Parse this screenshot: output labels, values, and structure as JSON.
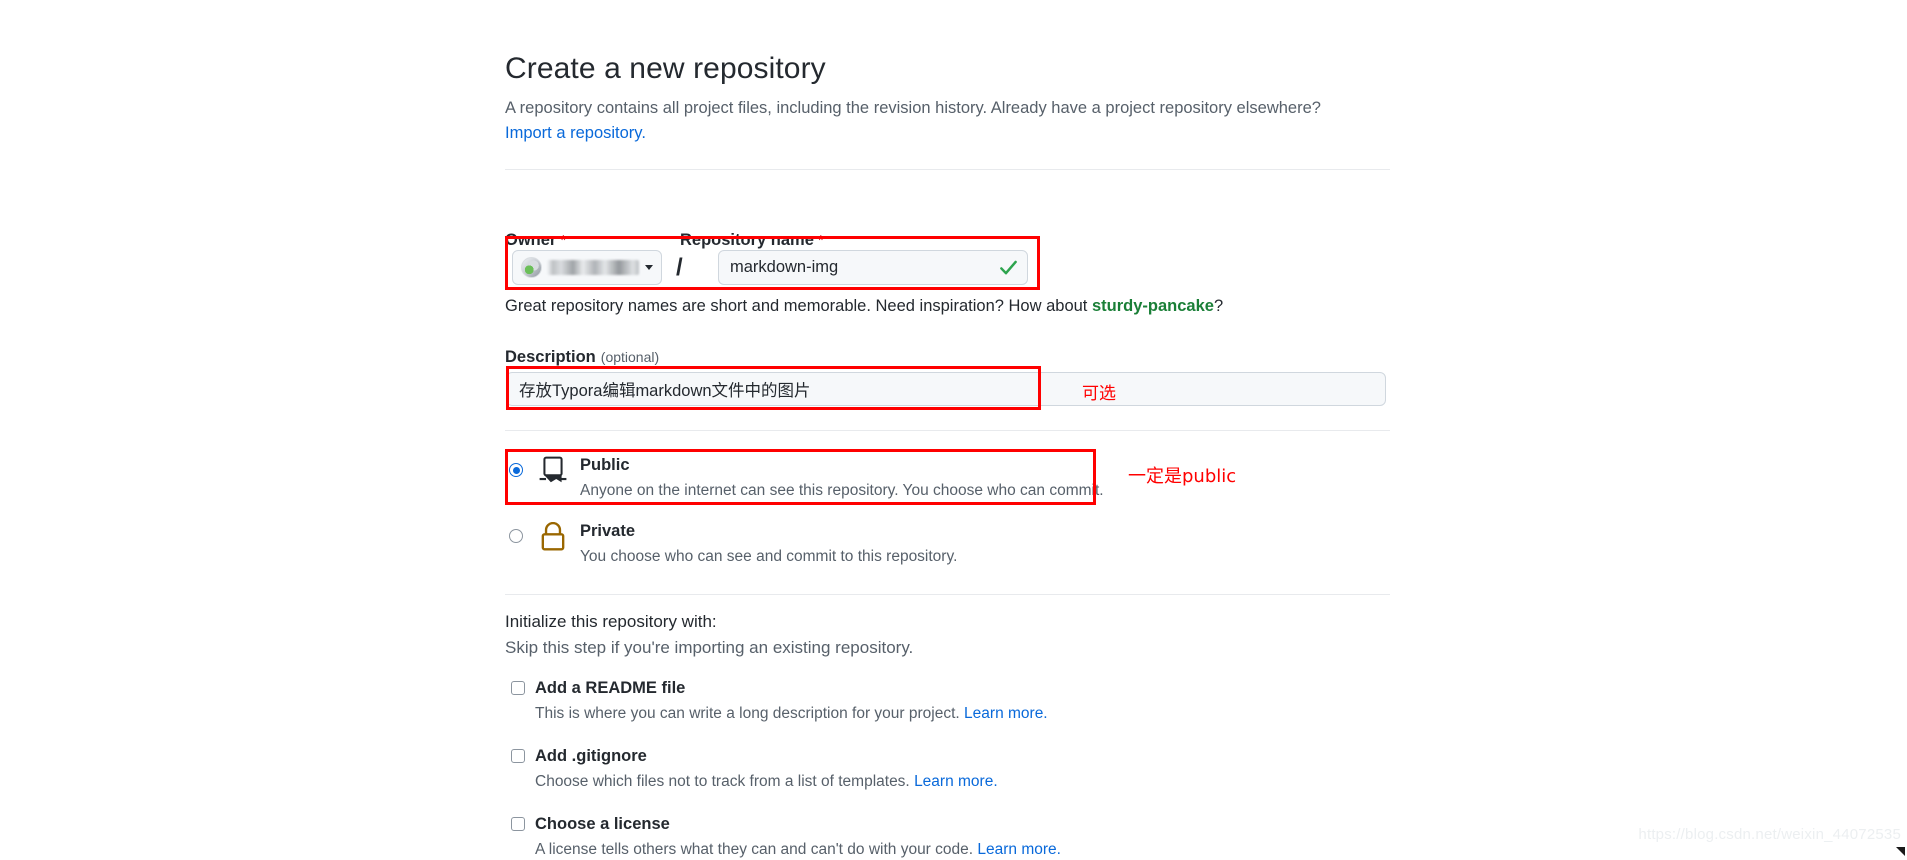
{
  "header": {
    "title": "Create a new repository",
    "subtitle": "A repository contains all project files, including the revision history. Already have a project repository elsewhere?",
    "import_link": "Import a repository."
  },
  "owner_field": {
    "label": "Owner",
    "required_mark": "*",
    "selected_value": "",
    "avatar_icon": "user-avatar-icon",
    "caret_icon": "chevron-down-icon"
  },
  "separator": "/",
  "repo_name_field": {
    "label": "Repository name",
    "required_mark": "*",
    "value": "markdown-img",
    "placeholder": "",
    "valid_icon": "check-icon"
  },
  "hint": {
    "prefix": "Great repository names are short and memorable. Need inspiration? How about ",
    "suggestion": "sturdy-pancake",
    "suffix": "?"
  },
  "description_field": {
    "label": "Description",
    "optional_note": "(optional)",
    "value": "存放Typora编辑markdown文件中的图片",
    "placeholder": ""
  },
  "visibility": {
    "public": {
      "title": "Public",
      "description": "Anyone on the internet can see this repository. You choose who can commit.",
      "selected": true,
      "icon": "open-book-icon"
    },
    "private": {
      "title": "Private",
      "description": "You choose who can see and commit to this repository.",
      "selected": false,
      "icon": "lock-icon"
    }
  },
  "initialize": {
    "title": "Initialize this repository with:",
    "subtitle": "Skip this step if you're importing an existing repository.",
    "options": [
      {
        "title": "Add a README file",
        "description": "This is where you can write a long description for your project.",
        "learn_more": "Learn more.",
        "checked": false
      },
      {
        "title": "Add .gitignore",
        "description": "Choose which files not to track from a list of templates.",
        "learn_more": "Learn more.",
        "checked": false
      },
      {
        "title": "Choose a license",
        "description": "A license tells others what they can and can't do with your code.",
        "learn_more": "Learn more.",
        "checked": false
      }
    ]
  },
  "annotations": {
    "optional_note_cn": "可选",
    "must_be_public_cn": "一定是public",
    "highlight_color": "#ff0000"
  },
  "watermark": {
    "text": "https://blog.csdn.net/weixin_44072535"
  },
  "colors": {
    "link": "#0969da",
    "suggestion_green": "#1a7f37",
    "required_red": "#cf222e",
    "annotation_red": "#ff0000",
    "lock_gold": "#9a6700",
    "text_primary": "#24292f",
    "text_muted": "#57606a",
    "input_bg": "#f6f8fa",
    "border": "#d0d7de"
  }
}
